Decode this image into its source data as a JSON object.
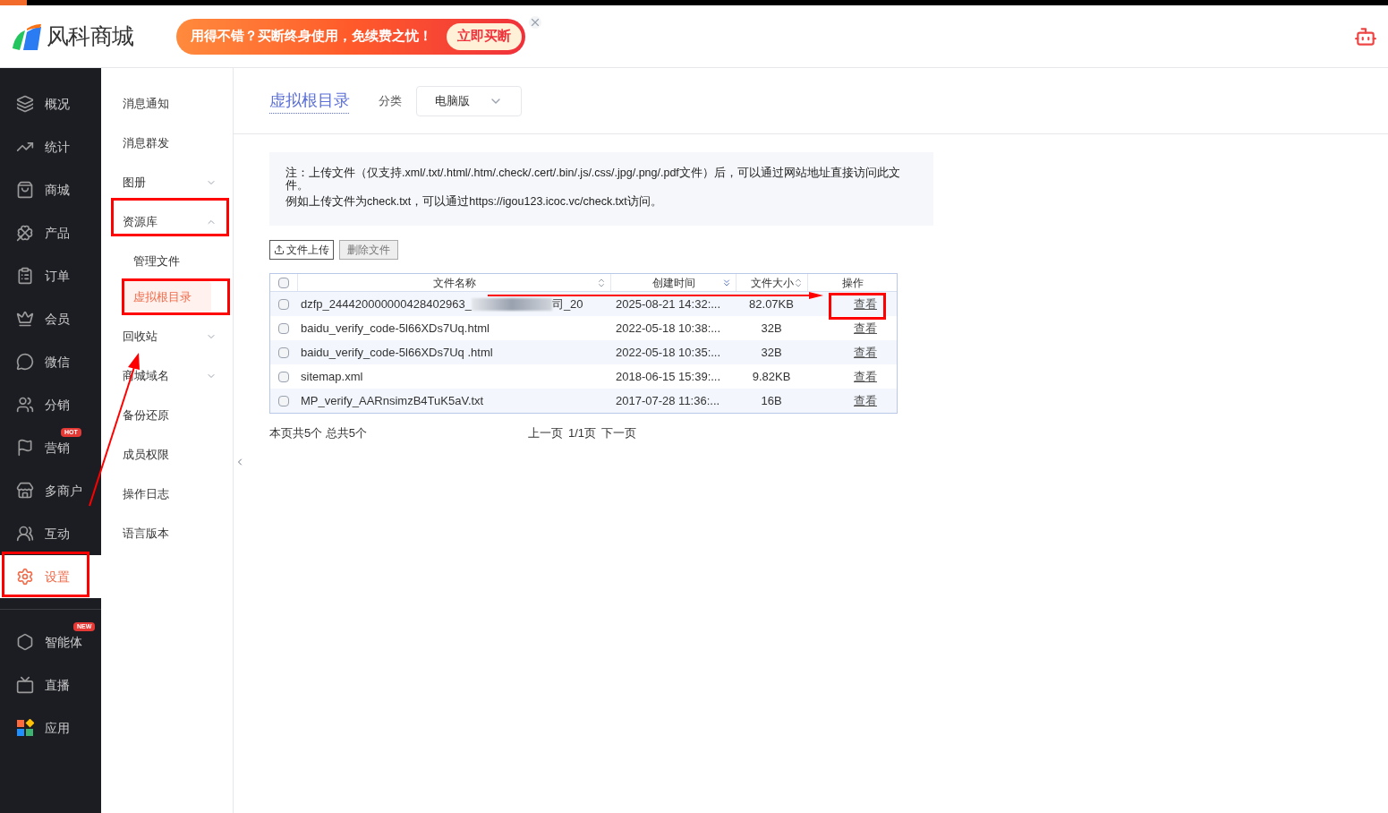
{
  "header": {
    "logo_text": "风科商城",
    "promo": {
      "text": "用得不错？买断终身使用，免续费之忧！",
      "button": "立即买断"
    }
  },
  "sidebar": {
    "items": [
      {
        "label": "概况",
        "selected": false
      },
      {
        "label": "统计",
        "selected": false
      },
      {
        "label": "商城",
        "selected": false
      },
      {
        "label": "产品",
        "selected": false
      },
      {
        "label": "订单",
        "selected": false
      },
      {
        "label": "会员",
        "selected": false
      },
      {
        "label": "微信",
        "selected": false
      },
      {
        "label": "分销",
        "selected": false
      },
      {
        "label": "营销",
        "selected": false,
        "badge": "HOT"
      },
      {
        "label": "多商户",
        "selected": false
      },
      {
        "label": "互动",
        "selected": false
      },
      {
        "label": "设置",
        "selected": true
      }
    ],
    "extra_items": [
      {
        "label": "智能体",
        "badge": "NEW"
      },
      {
        "label": "直播"
      },
      {
        "label": "应用"
      }
    ]
  },
  "submenu": {
    "items": [
      {
        "label": "消息通知",
        "kind": "item",
        "selected": false
      },
      {
        "label": "消息群发",
        "kind": "item",
        "selected": false
      },
      {
        "label": "图册",
        "kind": "group",
        "expanded": false
      },
      {
        "label": "资源库",
        "kind": "group",
        "expanded": true,
        "children": [
          {
            "label": "管理文件",
            "selected": false
          },
          {
            "label": "虚拟根目录",
            "selected": true
          }
        ]
      },
      {
        "label": "回收站",
        "kind": "group",
        "expanded": false
      },
      {
        "label": "商城域名",
        "kind": "group",
        "expanded": false
      },
      {
        "label": "备份还原",
        "kind": "item",
        "selected": false
      },
      {
        "label": "成员权限",
        "kind": "item",
        "selected": false
      },
      {
        "label": "操作日志",
        "kind": "item",
        "selected": false
      },
      {
        "label": "语言版本",
        "kind": "item",
        "selected": false
      }
    ]
  },
  "page": {
    "title": "虚拟根目录",
    "category_label": "分类",
    "category_value": "电脑版",
    "notice": [
      "注：上传文件（仅支持.xml/.txt/.html/.htm/.check/.cert/.bin/.js/.css/.jpg/.png/.pdf文件）后，可以通过网站地址直接访问此文件。",
      "例如上传文件为check.txt，可以通过https://igou123.icoc.vc/check.txt访问。"
    ],
    "buttons": [
      {
        "label": "文件上传",
        "kind": "upload"
      },
      {
        "label": "删除文件",
        "kind": "plain"
      }
    ],
    "table": {
      "select_all_checked": false,
      "columns": [
        {
          "label": "文件名称",
          "kind": "sortable"
        },
        {
          "label": "创建时间",
          "kind": "sorted"
        },
        {
          "label": "文件大小",
          "kind": "sortable"
        },
        {
          "label": "操作",
          "kind": "plain"
        }
      ],
      "rows": [
        {
          "checked": false,
          "name": "dzfp_244420000000428402963_",
          "name_hidden": true,
          "name_tail": "司_20",
          "created": "2025-08-21 14:32:...",
          "size": "82.07KB",
          "action": "查看"
        },
        {
          "checked": false,
          "name": "baidu_verify_code-5l66XDs7Uq.html",
          "name_hidden": false,
          "created": "2022-05-18 10:38:...",
          "size": "32B",
          "action": "查看"
        },
        {
          "checked": false,
          "name": "baidu_verify_code-5l66XDs7Uq .html",
          "name_hidden": false,
          "created": "2022-05-18 10:35:...",
          "size": "32B",
          "action": "查看"
        },
        {
          "checked": false,
          "name": "sitemap.xml",
          "name_hidden": false,
          "created": "2018-06-15 15:39:...",
          "size": "9.82KB",
          "action": "查看"
        },
        {
          "checked": false,
          "name": "MP_verify_AARnsimzB4TuK5aV.txt",
          "name_hidden": false,
          "created": "2017-07-28 11:36:...",
          "size": "16B",
          "action": "查看"
        }
      ]
    },
    "page_info": "本页共5个 总共5个",
    "pager": {
      "prev": "上一页",
      "current": "1/1页",
      "next": "下一页"
    }
  }
}
